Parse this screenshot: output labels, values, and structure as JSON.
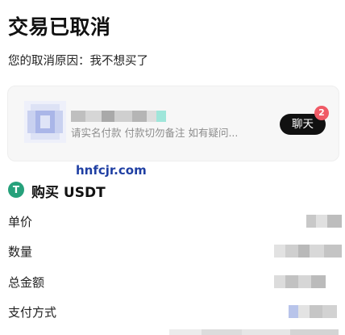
{
  "header": {
    "title": "交易已取消",
    "reason": "您的取消原因：我不想买了"
  },
  "merchant_card": {
    "message_preview": "请实名付款 付款切勿备注 如有疑问...",
    "chat_label": "聊天",
    "unread_count": "2"
  },
  "watermark": "hnfcjr.com",
  "order": {
    "coin_icon": "tether-icon",
    "coin_symbol": "T",
    "title": "购买 USDT",
    "rows": [
      {
        "label": "单价"
      },
      {
        "label": "数量"
      },
      {
        "label": "总金额"
      },
      {
        "label": "支付方式"
      }
    ]
  },
  "colors": {
    "accent_dark": "#111111",
    "badge": "#f05a66",
    "tether": "#26a17b",
    "watermark": "#1f3fa3"
  }
}
